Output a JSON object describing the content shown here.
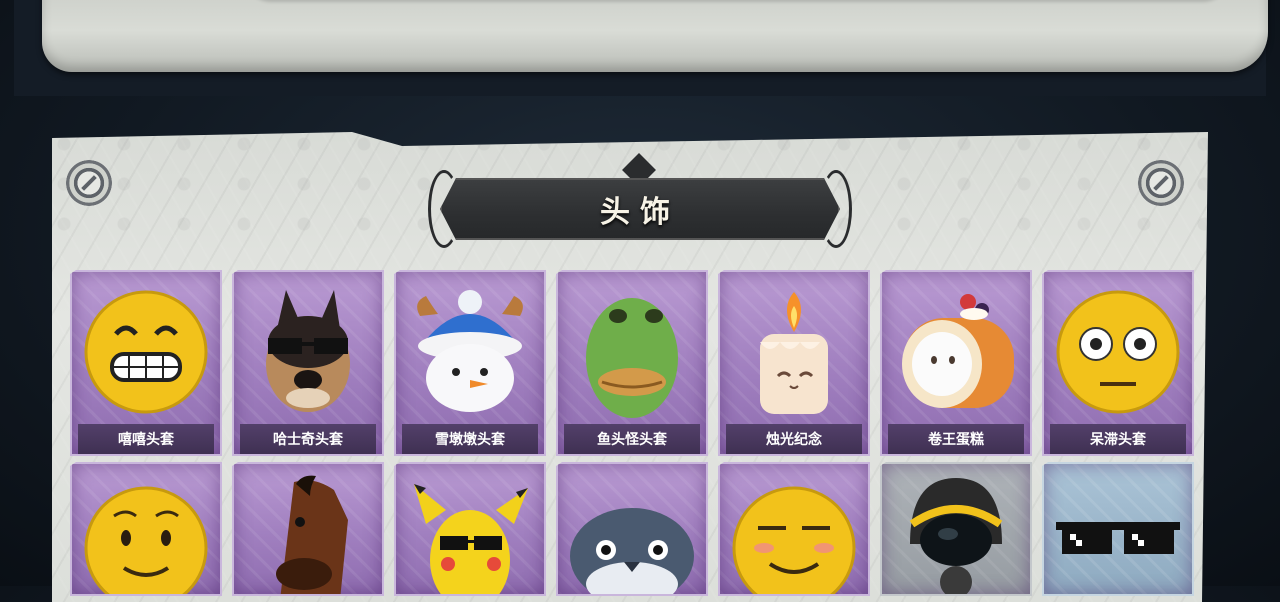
{
  "section_title": "头饰",
  "row1": [
    {
      "name": "嘻嘻头套",
      "icon": "grinning-face-mask-icon"
    },
    {
      "name": "哈士奇头套",
      "icon": "husky-sunglasses-mask-icon"
    },
    {
      "name": "雪墩墩头套",
      "icon": "snowman-reindeer-mask-icon"
    },
    {
      "name": "鱼头怪头套",
      "icon": "fish-head-mask-icon"
    },
    {
      "name": "烛光纪念",
      "icon": "candle-hat-icon"
    },
    {
      "name": "卷王蛋糕",
      "icon": "roll-cake-hat-icon"
    },
    {
      "name": "呆滞头套",
      "icon": "dazed-face-mask-icon"
    }
  ],
  "row2": [
    {
      "icon": "shy-smile-mask-icon",
      "rarity": "purple"
    },
    {
      "icon": "horse-head-mask-icon",
      "rarity": "purple"
    },
    {
      "icon": "pikachu-sunglasses-mask-icon",
      "rarity": "purple"
    },
    {
      "icon": "whale-mask-icon",
      "rarity": "purple"
    },
    {
      "icon": "smug-face-mask-icon",
      "rarity": "purple"
    },
    {
      "icon": "gas-mask-helmet-icon",
      "rarity": "gray"
    },
    {
      "icon": "pixel-sunglasses-icon",
      "rarity": "blue"
    }
  ]
}
